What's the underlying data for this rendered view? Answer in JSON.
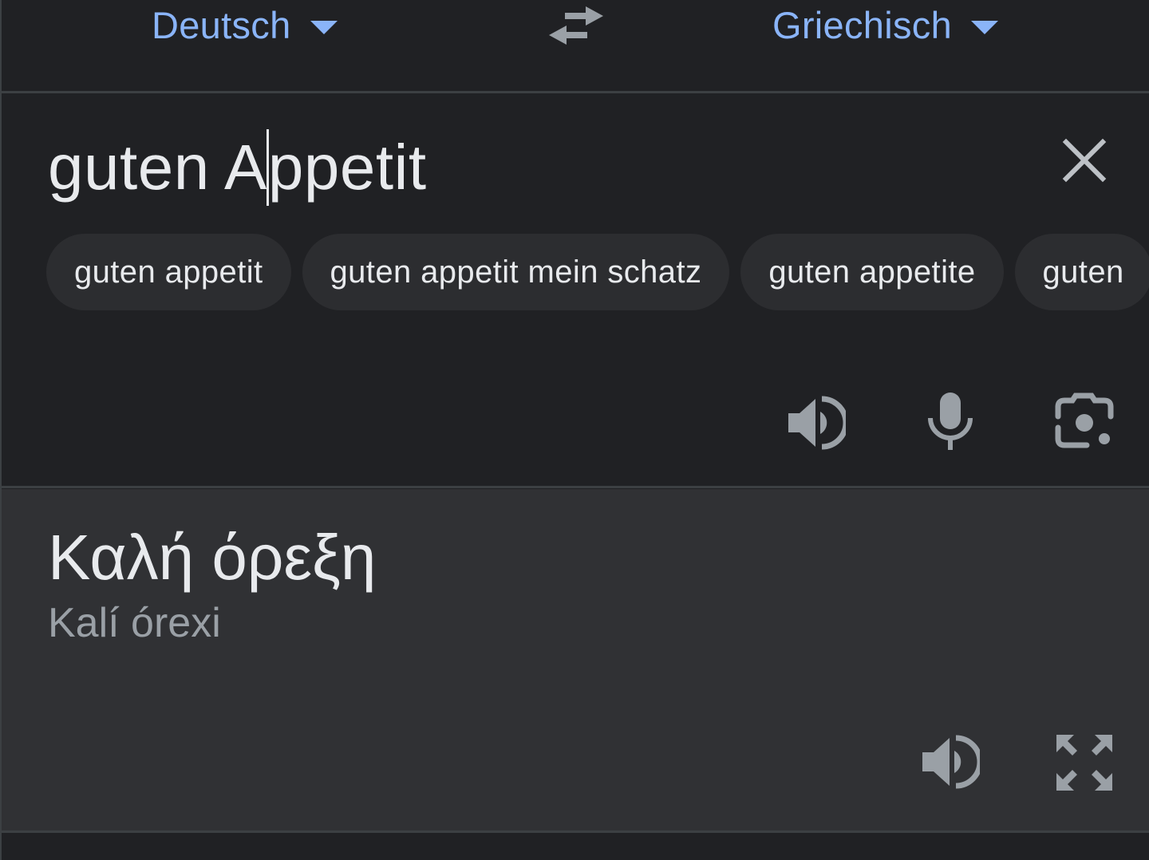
{
  "language_bar": {
    "source_language": "Deutsch",
    "target_language": "Griechisch"
  },
  "input": {
    "text_before_caret": "guten A",
    "text_after_caret": "ppetit"
  },
  "suggestions": [
    "guten appetit",
    "guten appetit mein schatz",
    "guten appetite",
    "guten"
  ],
  "output": {
    "translation": "Καλή όρεξη",
    "transliteration": "Kalí órexi"
  },
  "colors": {
    "accent": "#8ab4f8",
    "background": "#202124",
    "output_background": "#303134",
    "chip_background": "#2c2d30",
    "icon": "#9aa0a6",
    "text": "#e8eaed"
  },
  "icons": {
    "swap": "swap-languages-icon",
    "clear": "close-icon",
    "speak_source": "speaker-icon",
    "mic": "microphone-icon",
    "lens": "camera-icon",
    "speak_output": "speaker-icon",
    "expand": "fullscreen-icon"
  }
}
